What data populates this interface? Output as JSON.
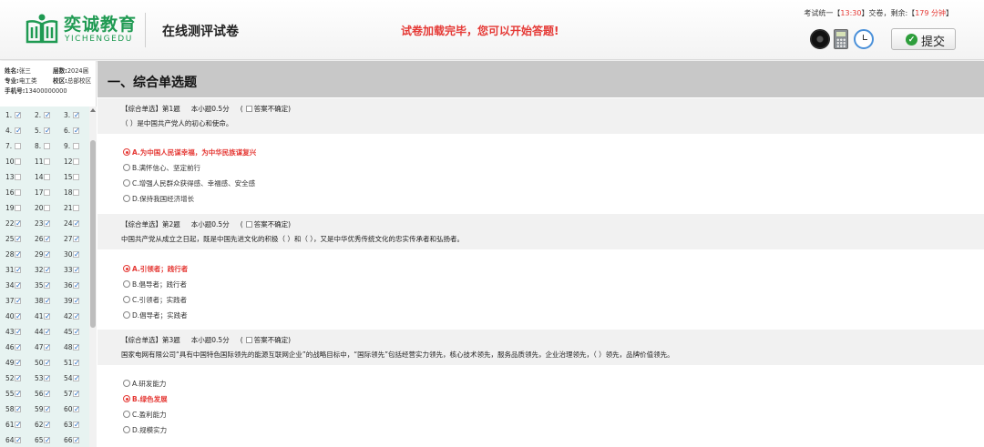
{
  "header": {
    "logo_cn": "奕诚教育",
    "logo_en": "YICHENGEDU",
    "page_title": "在线测评试卷",
    "status_message": "试卷加载完毕，您可以开始答题!",
    "exam_info_prefix": "考试统一【",
    "exam_time": "13:30",
    "exam_info_mid": "】交卷，剩余:【",
    "remaining": "179 分钟",
    "exam_info_suffix": "】",
    "submit_label": "提交",
    "tools": [
      "record-icon",
      "calculator-icon",
      "clock-icon"
    ]
  },
  "student": {
    "name_label": "姓名:",
    "name": "张三",
    "level_label": "层数:",
    "level": "2024届",
    "major_label": "专业:",
    "major": "电工类",
    "campus_label": "校区:",
    "campus": "总部校区",
    "phone_label": "手机号:",
    "phone": "13400000000"
  },
  "question_grid": [
    {
      "n": "1.",
      "c": true
    },
    {
      "n": "2.",
      "c": true
    },
    {
      "n": "3.",
      "c": true
    },
    {
      "n": "4.",
      "c": true
    },
    {
      "n": "5.",
      "c": true
    },
    {
      "n": "6.",
      "c": true
    },
    {
      "n": "7.",
      "c": false
    },
    {
      "n": "8.",
      "c": false
    },
    {
      "n": "9.",
      "c": false
    },
    {
      "n": "10.",
      "c": false
    },
    {
      "n": "11.",
      "c": false
    },
    {
      "n": "12.",
      "c": false
    },
    {
      "n": "13.",
      "c": false
    },
    {
      "n": "14.",
      "c": false
    },
    {
      "n": "15.",
      "c": false
    },
    {
      "n": "16.",
      "c": false
    },
    {
      "n": "17.",
      "c": false
    },
    {
      "n": "18.",
      "c": false
    },
    {
      "n": "19.",
      "c": false
    },
    {
      "n": "20.",
      "c": false
    },
    {
      "n": "21.",
      "c": false
    },
    {
      "n": "22.",
      "c": true
    },
    {
      "n": "23.",
      "c": true
    },
    {
      "n": "24.",
      "c": true
    },
    {
      "n": "25.",
      "c": true
    },
    {
      "n": "26.",
      "c": true
    },
    {
      "n": "27.",
      "c": true
    },
    {
      "n": "28.",
      "c": true
    },
    {
      "n": "29.",
      "c": true
    },
    {
      "n": "30.",
      "c": true
    },
    {
      "n": "31.",
      "c": true
    },
    {
      "n": "32.",
      "c": true
    },
    {
      "n": "33.",
      "c": true
    },
    {
      "n": "34.",
      "c": true
    },
    {
      "n": "35.",
      "c": true
    },
    {
      "n": "36.",
      "c": true
    },
    {
      "n": "37.",
      "c": true
    },
    {
      "n": "38.",
      "c": true
    },
    {
      "n": "39.",
      "c": true
    },
    {
      "n": "40.",
      "c": true
    },
    {
      "n": "41.",
      "c": true
    },
    {
      "n": "42.",
      "c": true
    },
    {
      "n": "43.",
      "c": true
    },
    {
      "n": "44.",
      "c": true
    },
    {
      "n": "45.",
      "c": true
    },
    {
      "n": "46.",
      "c": true
    },
    {
      "n": "47.",
      "c": true
    },
    {
      "n": "48.",
      "c": true
    },
    {
      "n": "49.",
      "c": true
    },
    {
      "n": "50.",
      "c": true
    },
    {
      "n": "51.",
      "c": true
    },
    {
      "n": "52.",
      "c": true
    },
    {
      "n": "53.",
      "c": true
    },
    {
      "n": "54.",
      "c": true
    },
    {
      "n": "55.",
      "c": true
    },
    {
      "n": "56.",
      "c": true
    },
    {
      "n": "57.",
      "c": true
    },
    {
      "n": "58.",
      "c": true
    },
    {
      "n": "59.",
      "c": true
    },
    {
      "n": "60.",
      "c": true
    },
    {
      "n": "61.",
      "c": true
    },
    {
      "n": "62.",
      "c": true
    },
    {
      "n": "63.",
      "c": true
    },
    {
      "n": "64.",
      "c": true
    },
    {
      "n": "65.",
      "c": true
    },
    {
      "n": "66.",
      "c": true
    }
  ],
  "section_title": "一、综合单选题",
  "questions": [
    {
      "meta": "【综合单选】第1题",
      "score": "本小题0.5分",
      "unsure": "答案不确定",
      "text": "（    ）是中国共产党人的初心和使命。",
      "options": [
        {
          "label": "A.为中国人民谋幸福，为中华民族谋复兴",
          "selected": true
        },
        {
          "label": "B.满怀信心、坚定前行",
          "selected": false
        },
        {
          "label": "C.增强人民群众获得感、幸福感、安全感",
          "selected": false
        },
        {
          "label": "D.保持我国经济增长",
          "selected": false
        }
      ]
    },
    {
      "meta": "【综合单选】第2题",
      "score": "本小题0.5分",
      "unsure": "答案不确定",
      "text": "中国共产党从成立之日起，既是中国先进文化的积极（    ）和（    ），又是中华优秀传统文化的忠实传承者和弘扬者。",
      "options": [
        {
          "label": "A.引领者；践行者",
          "selected": true
        },
        {
          "label": "B.倡导者；践行者",
          "selected": false
        },
        {
          "label": "C.引领者；实践者",
          "selected": false
        },
        {
          "label": "D.倡导者；实践者",
          "selected": false
        }
      ]
    },
    {
      "meta": "【综合单选】第3题",
      "score": "本小题0.5分",
      "unsure": "答案不确定",
      "text": "国家电网有限公司“具有中国特色国际领先的能源互联网企业”的战略目标中，“国际领先”包括经营实力领先，核心技术领先，服务品质领先，企业治理领先，（    ）领先，品牌价值领先。",
      "options": [
        {
          "label": "A.研发能力",
          "selected": false
        },
        {
          "label": "B.绿色发展",
          "selected": true
        },
        {
          "label": "C.盈利能力",
          "selected": false
        },
        {
          "label": "D.规模实力",
          "selected": false
        }
      ]
    }
  ],
  "colors": {
    "brand_green": "#1f9a52",
    "alert_red": "#e53935",
    "grid_bg": "#e7f3f1"
  }
}
